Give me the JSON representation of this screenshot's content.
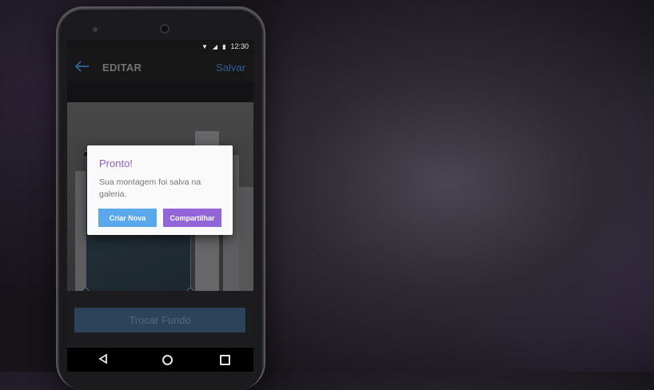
{
  "status_bar": {
    "time": "12:30",
    "wifi_icon": "wifi-icon",
    "signal_icon": "signal-icon",
    "battery_icon": "battery-icon"
  },
  "app_bar": {
    "title": "EDITAR",
    "save_label": "Salvar",
    "back_icon": "arrow-back-icon"
  },
  "editor": {
    "swap_background_label": "Trocar Fundo"
  },
  "dialog": {
    "title": "Pronto!",
    "message": "Sua montagem foi salva na galeria.",
    "new_label": "Criar Nova",
    "share_label": "Compartilhar"
  },
  "nav_bar": {
    "back_icon": "nav-back-icon",
    "home_icon": "nav-home-icon",
    "recents_icon": "nav-recents-icon"
  },
  "colors": {
    "accent_blue": "#5aa8ec",
    "accent_purple": "#9266d8",
    "title_purple": "#8d5ecb",
    "link_blue": "#3d7cc9"
  }
}
